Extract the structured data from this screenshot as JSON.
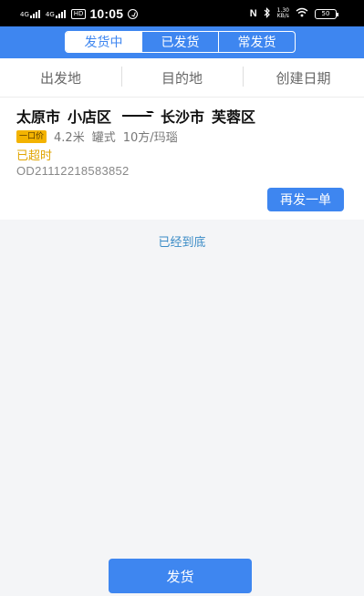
{
  "status_bar": {
    "network_1": "4G",
    "network_2": "4G",
    "hd": "HD",
    "time": "10:05",
    "nfc": "N",
    "speed": "1.30\nKB/s",
    "battery": "50"
  },
  "tabs": [
    {
      "label": "发货中",
      "active": true
    },
    {
      "label": "已发货",
      "active": false
    },
    {
      "label": "常发货",
      "active": false
    }
  ],
  "filters": [
    "出发地",
    "目的地",
    "创建日期"
  ],
  "orders": [
    {
      "origin_city": "太原市",
      "origin_district": "小店区",
      "dest_city": "长沙市",
      "dest_district": "芙蓉区",
      "price_badge": "一口价",
      "length": "4.2米",
      "truck_type": "罐式",
      "volume": "10方/玛瑙",
      "status": "已超时",
      "order_no": "OD21112218583852",
      "resend_label": "再发一单"
    }
  ],
  "end_tip": "已经到底",
  "ship_button": "发货",
  "colors": {
    "primary": "#3e86f0",
    "warning": "#e0a400",
    "badge": "#f3b300"
  }
}
